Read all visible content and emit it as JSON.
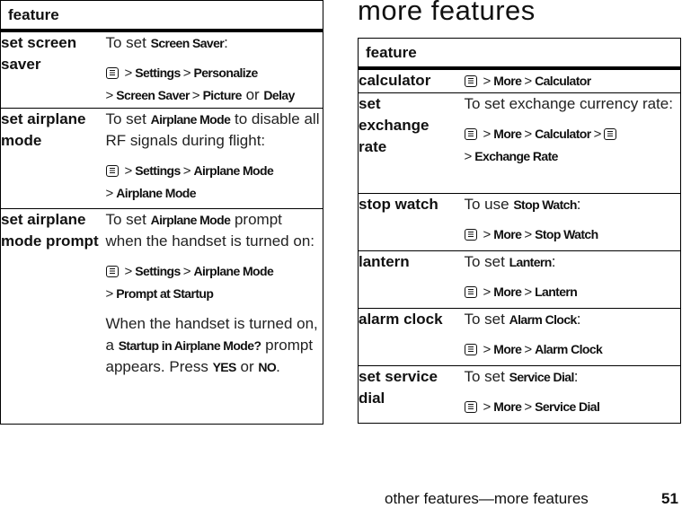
{
  "left_table": {
    "header": "feature",
    "rows": [
      {
        "feature": "set screen saver",
        "intro_prefix": "To set ",
        "intro_key": "Screen Saver",
        "intro_suffix": ":",
        "path": [
          "Settings",
          "Personalize",
          "Screen Saver",
          "Picture"
        ],
        "path_alt_connector": "or",
        "path_alt": "Delay"
      },
      {
        "feature": "set airplane mode",
        "intro_prefix": "To set ",
        "intro_key": "Airplane Mode",
        "intro_suffix": " to disable all RF signals during flight:",
        "path": [
          "Settings",
          "Airplane Mode",
          "Airplane Mode"
        ]
      },
      {
        "feature": "set airplane mode prompt",
        "intro_prefix": "To set ",
        "intro_key": "Airplane Mode",
        "intro_suffix": " prompt when the handset is turned on:",
        "path": [
          "Settings",
          "Airplane Mode",
          "Prompt at Startup"
        ],
        "note_prefix": "When the handset is turned on, a ",
        "note_key": "Startup in Airplane Mode?",
        "note_mid": " prompt appears. Press ",
        "note_yes": "YES",
        "note_or": " or ",
        "note_no": "NO",
        "note_end": "."
      }
    ]
  },
  "section_title": "more features",
  "right_table": {
    "header": "feature",
    "rows": [
      {
        "feature": "calculator",
        "path": [
          "More",
          "Calculator"
        ]
      },
      {
        "feature": "set exchange rate",
        "intro": "To set exchange currency rate:",
        "path": [
          "More",
          "Calculator"
        ],
        "path2": [
          "Exchange Rate"
        ]
      },
      {
        "feature": "stop watch",
        "intro_prefix": "To use ",
        "intro_key": "Stop Watch",
        "intro_suffix": ":",
        "path": [
          "More",
          "Stop Watch"
        ]
      },
      {
        "feature": "lantern",
        "intro_prefix": "To set ",
        "intro_key": "Lantern",
        "intro_suffix": ":",
        "path": [
          "More",
          "Lantern"
        ]
      },
      {
        "feature": "alarm clock",
        "intro_prefix": "To set ",
        "intro_key": "Alarm Clock",
        "intro_suffix": ":",
        "path": [
          "More",
          "Alarm Clock"
        ]
      },
      {
        "feature": "set service dial",
        "intro_prefix": "To set ",
        "intro_key": "Service Dial",
        "intro_suffix": ":",
        "path": [
          "More",
          "Service Dial"
        ]
      }
    ]
  },
  "footer": {
    "title": "other features—more features",
    "page_number": "51"
  },
  "icons": {
    "menu": "menu-key-icon",
    "separator": ">"
  }
}
